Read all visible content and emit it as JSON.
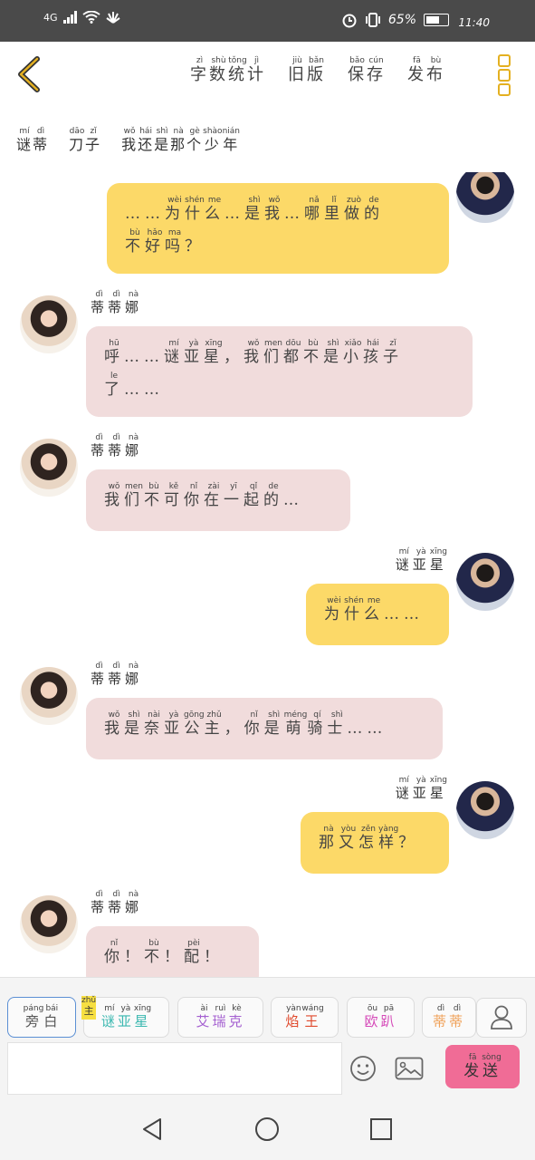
{
  "status_bar": {
    "network": "4G",
    "battery_percent": "65%",
    "time": "11:40"
  },
  "header": {
    "menu": [
      {
        "label": "字数统计",
        "ruby": [
          "zì",
          "shù",
          "tǒng",
          "jì"
        ]
      },
      {
        "label": "旧版",
        "ruby": [
          "jiù",
          "bǎn"
        ]
      },
      {
        "label": "保存",
        "ruby": [
          "bǎo",
          "cún"
        ]
      },
      {
        "label": "发布",
        "ruby": [
          "fā",
          "bù"
        ]
      }
    ]
  },
  "title": [
    {
      "text": "谜蒂",
      "ruby": [
        "mí",
        "dì"
      ]
    },
    {
      "text": "刀子",
      "ruby": [
        "dāo",
        "zǐ"
      ]
    },
    {
      "text": "我还是那个少年",
      "ruby": [
        "wǒ",
        "hái",
        "shì",
        "nà",
        "gè",
        "shào",
        "nián"
      ]
    }
  ],
  "messages": [
    {
      "side": "right",
      "color": "yellow",
      "name": "",
      "lines": [
        [
          [
            "……",
            ""
          ],
          [
            "为",
            "wèi"
          ],
          [
            "什",
            "shén"
          ],
          [
            "么",
            "me"
          ],
          [
            "…",
            ""
          ],
          [
            "是",
            "shì"
          ],
          [
            "我",
            "wǒ"
          ],
          [
            "…",
            ""
          ],
          [
            "哪",
            "nǎ"
          ],
          [
            "里",
            "lǐ"
          ],
          [
            "做",
            "zuò"
          ],
          [
            "的",
            "de"
          ]
        ],
        [
          [
            "不",
            "bù"
          ],
          [
            "好",
            "hǎo"
          ],
          [
            "吗",
            "ma"
          ],
          [
            "？",
            ""
          ]
        ]
      ]
    },
    {
      "side": "left",
      "color": "pink",
      "name": "蒂蒂娜",
      "name_ruby": [
        "dì",
        "dì",
        "nà"
      ],
      "lines": [
        [
          [
            "呼",
            "hū"
          ],
          [
            "……",
            ""
          ],
          [
            "谜",
            "mí"
          ],
          [
            "亚",
            "yà"
          ],
          [
            "星",
            "xīng"
          ],
          [
            "，",
            ""
          ],
          [
            "我",
            "wǒ"
          ],
          [
            "们",
            "men"
          ],
          [
            "都",
            "dōu"
          ],
          [
            "不",
            "bù"
          ],
          [
            "是",
            "shì"
          ],
          [
            "小",
            "xiǎo"
          ],
          [
            "孩",
            "hái"
          ],
          [
            "子",
            "zǐ"
          ]
        ],
        [
          [
            "了",
            "le"
          ],
          [
            "……",
            ""
          ]
        ]
      ]
    },
    {
      "side": "left",
      "color": "pink",
      "name": "蒂蒂娜",
      "name_ruby": [
        "dì",
        "dì",
        "nà"
      ],
      "lines": [
        [
          [
            "我",
            "wǒ"
          ],
          [
            "们",
            "men"
          ],
          [
            "不",
            "bù"
          ],
          [
            "可",
            "kě"
          ],
          [
            "你",
            "nǐ"
          ],
          [
            "在",
            "zài"
          ],
          [
            "一",
            "yī"
          ],
          [
            "起",
            "qǐ"
          ],
          [
            "的",
            "de"
          ],
          [
            "…",
            ""
          ]
        ]
      ]
    },
    {
      "side": "right",
      "color": "yellow",
      "name": "谜亚星",
      "name_ruby": [
        "mí",
        "yà",
        "xīng"
      ],
      "lines": [
        [
          [
            "为",
            "wèi"
          ],
          [
            "什",
            "shén"
          ],
          [
            "么",
            "me"
          ],
          [
            "……",
            ""
          ]
        ]
      ]
    },
    {
      "side": "left",
      "color": "pink",
      "name": "蒂蒂娜",
      "name_ruby": [
        "dì",
        "dì",
        "nà"
      ],
      "lines": [
        [
          [
            "我",
            "wǒ"
          ],
          [
            "是",
            "shì"
          ],
          [
            "奈",
            "nài"
          ],
          [
            "亚",
            "yà"
          ],
          [
            "公",
            "gōng"
          ],
          [
            "主",
            "zhǔ"
          ],
          [
            "，",
            ""
          ],
          [
            "你",
            "nǐ"
          ],
          [
            "是",
            "shì"
          ],
          [
            "萌",
            "méng"
          ],
          [
            "骑",
            "qí"
          ],
          [
            "士",
            "shì"
          ],
          [
            "……",
            ""
          ]
        ]
      ]
    },
    {
      "side": "right",
      "color": "yellow",
      "name": "谜亚星",
      "name_ruby": [
        "mí",
        "yà",
        "xīng"
      ],
      "lines": [
        [
          [
            "那",
            "nà"
          ],
          [
            "又",
            "yòu"
          ],
          [
            "怎",
            "zěn"
          ],
          [
            "样",
            "yàng"
          ],
          [
            "？",
            ""
          ]
        ]
      ]
    },
    {
      "side": "left",
      "color": "pink",
      "name": "蒂蒂娜",
      "name_ruby": [
        "dì",
        "dì",
        "nà"
      ],
      "lines": [
        [
          [
            "你",
            "nǐ"
          ],
          [
            "！",
            ""
          ],
          [
            "不",
            "bù"
          ],
          [
            "！",
            ""
          ],
          [
            "配",
            "pèi"
          ],
          [
            "！",
            ""
          ]
        ]
      ]
    }
  ],
  "roles": [
    {
      "label": "旁白",
      "ruby": [
        "páng",
        "bái"
      ],
      "color": "#555555",
      "selected": true
    },
    {
      "label": "谜亚星",
      "ruby": [
        "mí",
        "yà",
        "xīng"
      ],
      "color": "#3bb8b0",
      "protagonist_tag": "主",
      "protagonist_ruby": "zhǔ"
    },
    {
      "label": "艾瑞克",
      "ruby": [
        "ài",
        "ruì",
        "kè"
      ],
      "color": "#a45fd0"
    },
    {
      "label": "焰王",
      "ruby": [
        "yàn",
        "wáng"
      ],
      "color": "#e04a2d"
    },
    {
      "label": "欧趴",
      "ruby": [
        "ōu",
        "pā"
      ],
      "color": "#d548b8"
    },
    {
      "label": "蒂蒂",
      "ruby": [
        "dì",
        "dì"
      ],
      "color": "#f0a25a"
    }
  ],
  "input": {
    "value": "",
    "send_label": "发送",
    "send_ruby": [
      "fā",
      "sòng"
    ]
  },
  "colors": {
    "yellow_bubble": "#fcd968",
    "pink_bubble": "#f1dcdc",
    "send_button": "#f06c96",
    "accent": "#e4b021"
  }
}
